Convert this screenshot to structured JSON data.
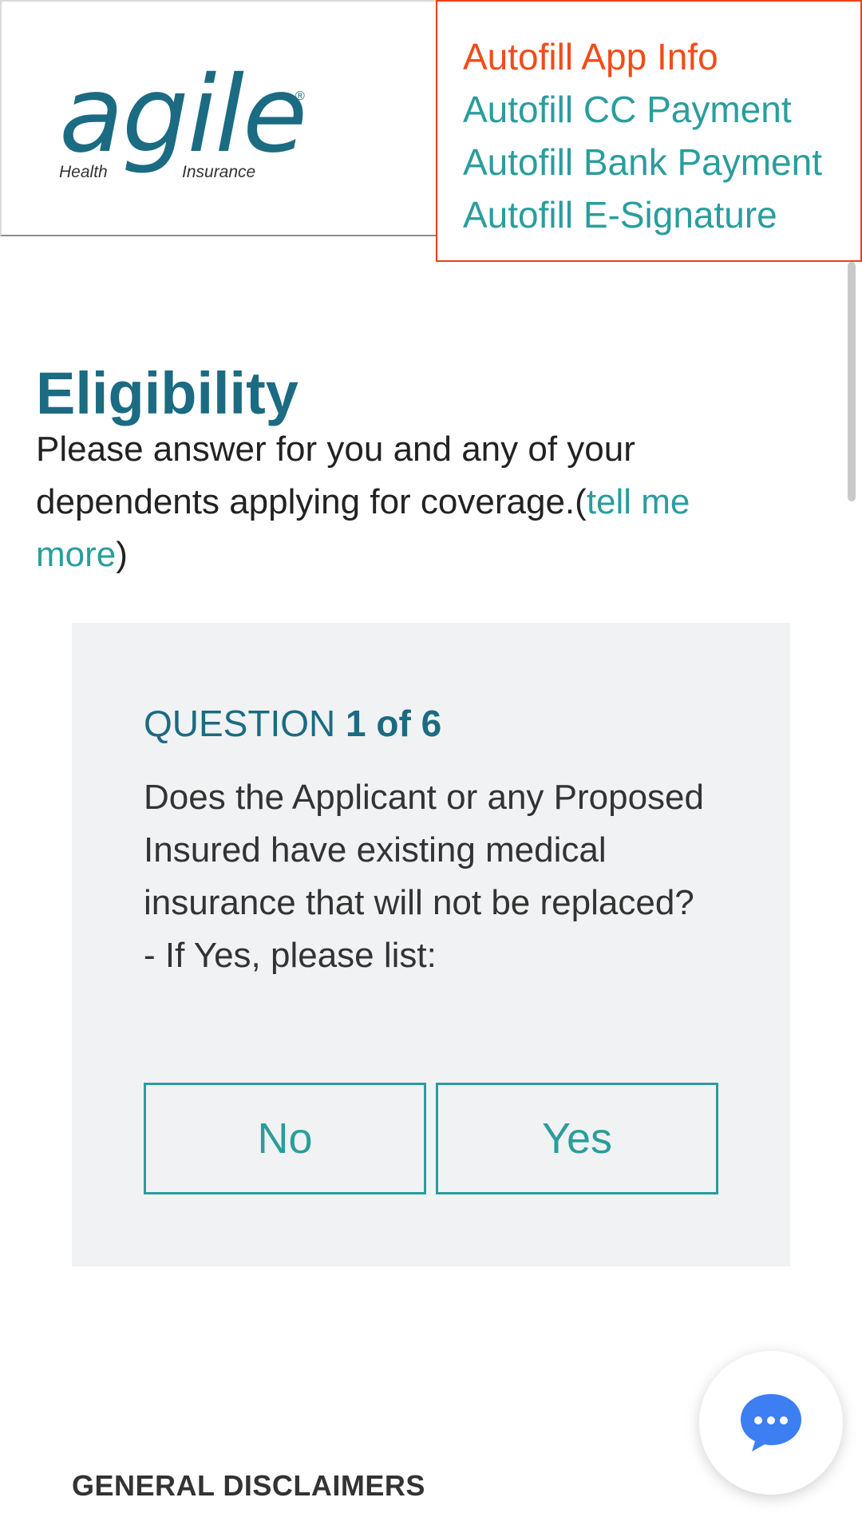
{
  "header": {
    "logo": {
      "wordmark": "agile",
      "registered": "®",
      "sub_left": "Health",
      "sub_right": "Insurance"
    }
  },
  "autofill_menu": {
    "items": [
      {
        "label": "Autofill App Info",
        "active": true
      },
      {
        "label": "Autofill CC Payment",
        "active": false
      },
      {
        "label": "Autofill Bank Payment",
        "active": false
      },
      {
        "label": "Autofill E-Signature",
        "active": false
      }
    ]
  },
  "eligibility": {
    "title": "Eligibility",
    "description": "Please answer for you and any of your dependents applying for coverage.(",
    "link_text": "tell me more",
    "description_end": ")"
  },
  "question": {
    "label_prefix": "QUESTION",
    "label_number": "1 of 6",
    "text_lines": [
      "Does the Applicant or any Proposed Insured have existing medical insurance that will not be replaced?",
      "- If Yes, please list:"
    ],
    "no_label": "No",
    "yes_label": "Yes"
  },
  "footer": {
    "disclaimers_title": "GENERAL DISCLAIMERS"
  },
  "icons": {
    "chat": "chat-bubble-icon"
  },
  "colors": {
    "brand_blue": "#1b6b82",
    "teal": "#2a9d9d",
    "accent_orange": "#f04c1a"
  }
}
